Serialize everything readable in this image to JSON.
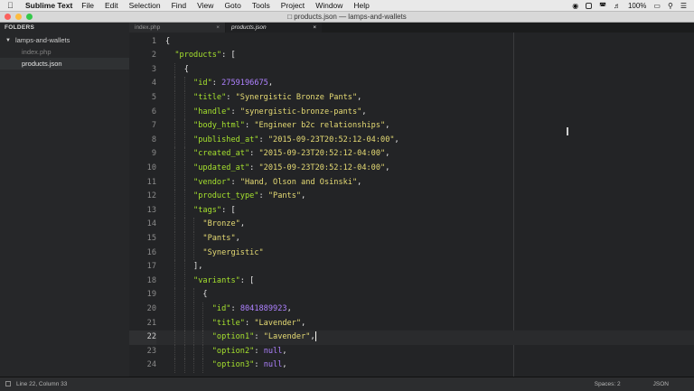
{
  "menubar": {
    "app": "Sublime Text",
    "items": [
      "File",
      "Edit",
      "Selection",
      "Find",
      "View",
      "Goto",
      "Tools",
      "Project",
      "Window",
      "Help"
    ],
    "battery": "100%"
  },
  "window": {
    "title": "products.json — lamps-and-wallets"
  },
  "sidebar": {
    "header": "FOLDERS",
    "folder": "lamps-and-wallets",
    "files": [
      "index.php",
      "products.json"
    ]
  },
  "tabs": [
    {
      "label": "index.php"
    },
    {
      "label": "products.json"
    }
  ],
  "editor": {
    "current_line": 22,
    "lines": [
      "{",
      "  \"products\": [",
      "    {",
      "      \"id\": 2759196675,",
      "      \"title\": \"Synergistic Bronze Pants\",",
      "      \"handle\": \"synergistic-bronze-pants\",",
      "      \"body_html\": \"Engineer b2c relationships\",",
      "      \"published_at\": \"2015-09-23T20:52:12-04:00\",",
      "      \"created_at\": \"2015-09-23T20:52:12-04:00\",",
      "      \"updated_at\": \"2015-09-23T20:52:12-04:00\",",
      "      \"vendor\": \"Hand, Olson and Osinski\",",
      "      \"product_type\": \"Pants\",",
      "      \"tags\": [",
      "        \"Bronze\",",
      "        \"Pants\",",
      "        \"Synergistic\"",
      "      ],",
      "      \"variants\": [",
      "        {",
      "          \"id\": 8041889923,",
      "          \"title\": \"Lavender\",",
      "          \"option1\": \"Lavender\",",
      "          \"option2\": null,",
      "          \"option3\": null,"
    ]
  },
  "statusbar": {
    "position": "Line 22, Column 33",
    "spaces": "Spaces: 2",
    "syntax": "JSON"
  },
  "colors": {
    "key": "#a6e22e",
    "string": "#e6db74",
    "number": "#ae81ff",
    "background": "#232426"
  }
}
